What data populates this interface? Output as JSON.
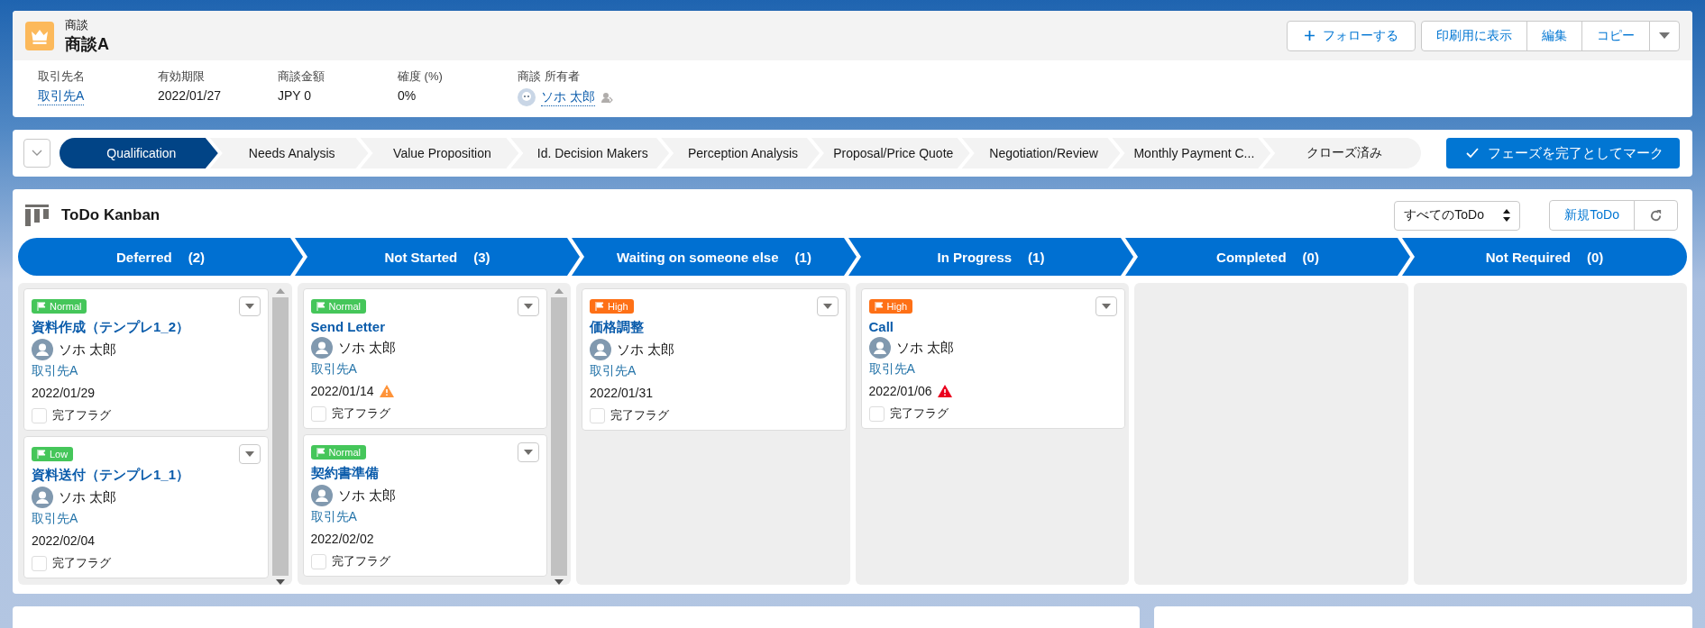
{
  "record": {
    "object_label": "商談",
    "name": "商談A"
  },
  "actions": [
    {
      "label": "フォローする",
      "kind": "follow"
    },
    {
      "label": "印刷用に表示",
      "kind": "plain"
    },
    {
      "label": "編集",
      "kind": "plain"
    },
    {
      "label": "コピー",
      "kind": "plain"
    }
  ],
  "fields": [
    {
      "label": "取引先名",
      "value": "取引先A",
      "kind": "link"
    },
    {
      "label": "有効期限",
      "value": "2022/01/27",
      "kind": "text"
    },
    {
      "label": "商談金額",
      "value": "JPY 0",
      "kind": "text"
    },
    {
      "label": "確度 (%)",
      "value": "0%",
      "kind": "text"
    },
    {
      "label": "商談 所有者",
      "value": "ソホ 太郎",
      "kind": "owner"
    }
  ],
  "path": {
    "stages": [
      {
        "label": "Qualification",
        "selected": true
      },
      {
        "label": "Needs Analysis",
        "selected": false
      },
      {
        "label": "Value Proposition",
        "selected": false
      },
      {
        "label": "Id. Decision Makers",
        "selected": false
      },
      {
        "label": "Perception Analysis",
        "selected": false
      },
      {
        "label": "Proposal/Price Quote",
        "selected": false
      },
      {
        "label": "Negotiation/Review",
        "selected": false
      },
      {
        "label": "Monthly Payment C...",
        "selected": false
      },
      {
        "label": "クローズ済み",
        "selected": false
      }
    ],
    "complete_button": "フェーズを完了としてマーク"
  },
  "kanban": {
    "title": "ToDo Kanban",
    "filter": "すべてのToDo",
    "new_button": "新規ToDo",
    "columns": [
      {
        "name": "Deferred",
        "count": "(2)",
        "cards": [
          {
            "priority": "Normal",
            "color": "#45c65a",
            "title": "資料作成（テンプレ1_2）",
            "owner": "ソホ 太郎",
            "account": "取引先A",
            "date": "2022/01/29",
            "warning": false,
            "error": false,
            "flag_label": "完了フラグ",
            "checked": false
          },
          {
            "priority": "Low",
            "color": "#45c65a",
            "title": "資料送付（テンプレ1_1）",
            "owner": "ソホ 太郎",
            "account": "取引先A",
            "date": "2022/02/04",
            "warning": false,
            "error": false,
            "flag_label": "完了フラグ",
            "checked": false
          }
        ]
      },
      {
        "name": "Not Started",
        "count": "(3)",
        "cards": [
          {
            "priority": "Normal",
            "color": "#45c65a",
            "title": "Send Letter",
            "owner": "ソホ 太郎",
            "account": "取引先A",
            "date": "2022/01/14",
            "warning": true,
            "error": false,
            "flag_label": "完了フラグ",
            "checked": false
          },
          {
            "priority": "Normal",
            "color": "#45c65a",
            "title": "契約書準備",
            "owner": "ソホ 太郎",
            "account": "取引先A",
            "date": "2022/02/02",
            "warning": false,
            "error": false,
            "flag_label": "完了フラグ",
            "checked": false
          }
        ]
      },
      {
        "name": "Waiting on someone else",
        "count": "(1)",
        "cards": [
          {
            "priority": "High",
            "color": "#fe7016",
            "title": "価格調整",
            "owner": "ソホ 太郎",
            "account": "取引先A",
            "date": "2022/01/31",
            "warning": false,
            "error": false,
            "flag_label": "完了フラグ",
            "checked": false
          }
        ]
      },
      {
        "name": "In Progress",
        "count": "(1)",
        "cards": [
          {
            "priority": "High",
            "color": "#fe7016",
            "title": "Call",
            "owner": "ソホ 太郎",
            "account": "取引先A",
            "date": "2022/01/06",
            "warning": false,
            "error": true,
            "flag_label": "完了フラグ",
            "checked": false
          }
        ]
      },
      {
        "name": "Completed",
        "count": "(0)"
      },
      {
        "name": "Not Required",
        "count": "(0)"
      }
    ]
  }
}
